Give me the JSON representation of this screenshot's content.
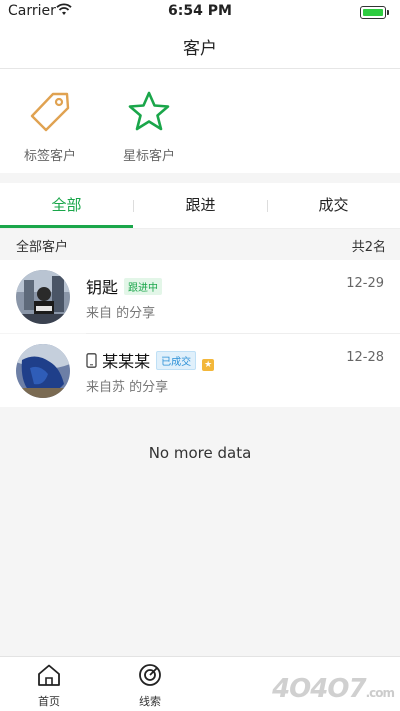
{
  "status_bar": {
    "carrier": "Carrier",
    "time": "6:54 PM"
  },
  "nav": {
    "title": "客户"
  },
  "quick_actions": [
    {
      "label": "标签客户",
      "icon": "tag-icon",
      "color": "#e0a251"
    },
    {
      "label": "星标客户",
      "icon": "star-icon",
      "color": "#1aa64a"
    }
  ],
  "tabs": [
    {
      "label": "全部",
      "active": true
    },
    {
      "label": "跟进",
      "active": false
    },
    {
      "label": "成交",
      "active": false
    }
  ],
  "summary": {
    "left": "全部客户",
    "right": "共2名"
  },
  "customers": [
    {
      "name": "钥匙",
      "badge": "跟进中",
      "sub": "来自 的分享",
      "date": "12-29"
    },
    {
      "name": "某某某",
      "badge": "已成交",
      "sub": "来自苏 的分享",
      "date": "12-28"
    }
  ],
  "no_more": "No more data",
  "tabbar": [
    {
      "label": "首页",
      "icon": "home-icon"
    },
    {
      "label": "线索",
      "icon": "target-icon"
    }
  ],
  "watermark": {
    "text": "4O4O7",
    "domain": ".com"
  },
  "colors": {
    "accent": "#1aa64a",
    "tag": "#e0a251",
    "deal_badge": "#2a8fd6"
  }
}
